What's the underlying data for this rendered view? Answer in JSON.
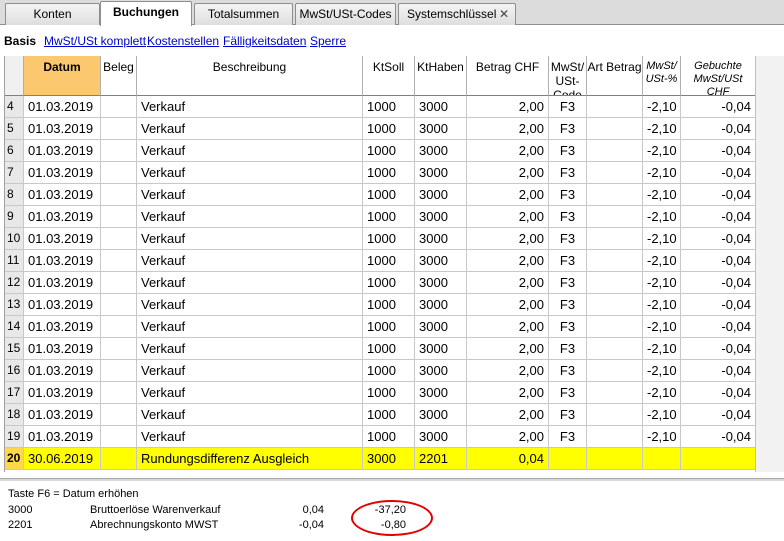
{
  "tabs": [
    {
      "label": "Konten"
    },
    {
      "label": "Buchungen"
    },
    {
      "label": "Totalsummen"
    },
    {
      "label": "MwSt/USt-Codes"
    },
    {
      "label": "Systemschlüssel"
    }
  ],
  "close_glyph": "✕",
  "subtabs": {
    "first": "Basis",
    "links": [
      "MwSt/USt komplett",
      "Kostenstellen",
      "Fälligkeitsdaten",
      "Sperre"
    ]
  },
  "columns": {
    "datum": "Datum",
    "beleg": "Beleg",
    "beschreibung": "Beschreibung",
    "ktsoll": "KtSoll",
    "kthaben": "KtHaben",
    "betrag": "Betrag CHF",
    "mwst": "MwSt/ USt-Code",
    "artbetrag": "Art Betrag",
    "mwstp": "MwSt/ USt-%",
    "gebucht": "Gebuchte MwSt/USt CHF"
  },
  "rows": [
    {
      "n": "4",
      "datum": "01.03.2019",
      "beleg": "",
      "beschreibung": "Verkauf",
      "ktsoll": "1000",
      "kthaben": "3000",
      "betrag": "2,00",
      "mwst": "F3",
      "artbetrag": "",
      "mwstp": "-2,10",
      "gebucht": "-0,04"
    },
    {
      "n": "5",
      "datum": "01.03.2019",
      "beleg": "",
      "beschreibung": "Verkauf",
      "ktsoll": "1000",
      "kthaben": "3000",
      "betrag": "2,00",
      "mwst": "F3",
      "artbetrag": "",
      "mwstp": "-2,10",
      "gebucht": "-0,04"
    },
    {
      "n": "6",
      "datum": "01.03.2019",
      "beleg": "",
      "beschreibung": "Verkauf",
      "ktsoll": "1000",
      "kthaben": "3000",
      "betrag": "2,00",
      "mwst": "F3",
      "artbetrag": "",
      "mwstp": "-2,10",
      "gebucht": "-0,04"
    },
    {
      "n": "7",
      "datum": "01.03.2019",
      "beleg": "",
      "beschreibung": "Verkauf",
      "ktsoll": "1000",
      "kthaben": "3000",
      "betrag": "2,00",
      "mwst": "F3",
      "artbetrag": "",
      "mwstp": "-2,10",
      "gebucht": "-0,04"
    },
    {
      "n": "8",
      "datum": "01.03.2019",
      "beleg": "",
      "beschreibung": "Verkauf",
      "ktsoll": "1000",
      "kthaben": "3000",
      "betrag": "2,00",
      "mwst": "F3",
      "artbetrag": "",
      "mwstp": "-2,10",
      "gebucht": "-0,04"
    },
    {
      "n": "9",
      "datum": "01.03.2019",
      "beleg": "",
      "beschreibung": "Verkauf",
      "ktsoll": "1000",
      "kthaben": "3000",
      "betrag": "2,00",
      "mwst": "F3",
      "artbetrag": "",
      "mwstp": "-2,10",
      "gebucht": "-0,04"
    },
    {
      "n": "10",
      "datum": "01.03.2019",
      "beleg": "",
      "beschreibung": "Verkauf",
      "ktsoll": "1000",
      "kthaben": "3000",
      "betrag": "2,00",
      "mwst": "F3",
      "artbetrag": "",
      "mwstp": "-2,10",
      "gebucht": "-0,04"
    },
    {
      "n": "11",
      "datum": "01.03.2019",
      "beleg": "",
      "beschreibung": "Verkauf",
      "ktsoll": "1000",
      "kthaben": "3000",
      "betrag": "2,00",
      "mwst": "F3",
      "artbetrag": "",
      "mwstp": "-2,10",
      "gebucht": "-0,04"
    },
    {
      "n": "12",
      "datum": "01.03.2019",
      "beleg": "",
      "beschreibung": "Verkauf",
      "ktsoll": "1000",
      "kthaben": "3000",
      "betrag": "2,00",
      "mwst": "F3",
      "artbetrag": "",
      "mwstp": "-2,10",
      "gebucht": "-0,04"
    },
    {
      "n": "13",
      "datum": "01.03.2019",
      "beleg": "",
      "beschreibung": "Verkauf",
      "ktsoll": "1000",
      "kthaben": "3000",
      "betrag": "2,00",
      "mwst": "F3",
      "artbetrag": "",
      "mwstp": "-2,10",
      "gebucht": "-0,04"
    },
    {
      "n": "14",
      "datum": "01.03.2019",
      "beleg": "",
      "beschreibung": "Verkauf",
      "ktsoll": "1000",
      "kthaben": "3000",
      "betrag": "2,00",
      "mwst": "F3",
      "artbetrag": "",
      "mwstp": "-2,10",
      "gebucht": "-0,04"
    },
    {
      "n": "15",
      "datum": "01.03.2019",
      "beleg": "",
      "beschreibung": "Verkauf",
      "ktsoll": "1000",
      "kthaben": "3000",
      "betrag": "2,00",
      "mwst": "F3",
      "artbetrag": "",
      "mwstp": "-2,10",
      "gebucht": "-0,04"
    },
    {
      "n": "16",
      "datum": "01.03.2019",
      "beleg": "",
      "beschreibung": "Verkauf",
      "ktsoll": "1000",
      "kthaben": "3000",
      "betrag": "2,00",
      "mwst": "F3",
      "artbetrag": "",
      "mwstp": "-2,10",
      "gebucht": "-0,04"
    },
    {
      "n": "17",
      "datum": "01.03.2019",
      "beleg": "",
      "beschreibung": "Verkauf",
      "ktsoll": "1000",
      "kthaben": "3000",
      "betrag": "2,00",
      "mwst": "F3",
      "artbetrag": "",
      "mwstp": "-2,10",
      "gebucht": "-0,04"
    },
    {
      "n": "18",
      "datum": "01.03.2019",
      "beleg": "",
      "beschreibung": "Verkauf",
      "ktsoll": "1000",
      "kthaben": "3000",
      "betrag": "2,00",
      "mwst": "F3",
      "artbetrag": "",
      "mwstp": "-2,10",
      "gebucht": "-0,04"
    },
    {
      "n": "19",
      "datum": "01.03.2019",
      "beleg": "",
      "beschreibung": "Verkauf",
      "ktsoll": "1000",
      "kthaben": "3000",
      "betrag": "2,00",
      "mwst": "F3",
      "artbetrag": "",
      "mwstp": "-2,10",
      "gebucht": "-0,04"
    },
    {
      "n": "20",
      "datum": "30.06.2019",
      "beleg": "",
      "beschreibung": "Rundungsdifferenz Ausgleich",
      "ktsoll": "3000",
      "kthaben": "2201",
      "betrag": "0,04",
      "mwst": "",
      "artbetrag": "",
      "mwstp": "",
      "gebucht": ""
    }
  ],
  "selected_row": 16,
  "info": {
    "hint": "Taste F6 = Datum erhöhen",
    "lines": [
      {
        "account": "3000",
        "name": "Bruttoerlöse Warenverkauf",
        "amount": "0,04",
        "balance": "-37,20"
      },
      {
        "account": "2201",
        "name": "Abrechnungskonto MWST",
        "amount": "-0,04",
        "balance": "-0,80"
      }
    ]
  },
  "colors": {
    "highlight": "#ffff00",
    "datum_header": "#fbc870",
    "circle": "#e00000",
    "link": "#0000cc"
  }
}
